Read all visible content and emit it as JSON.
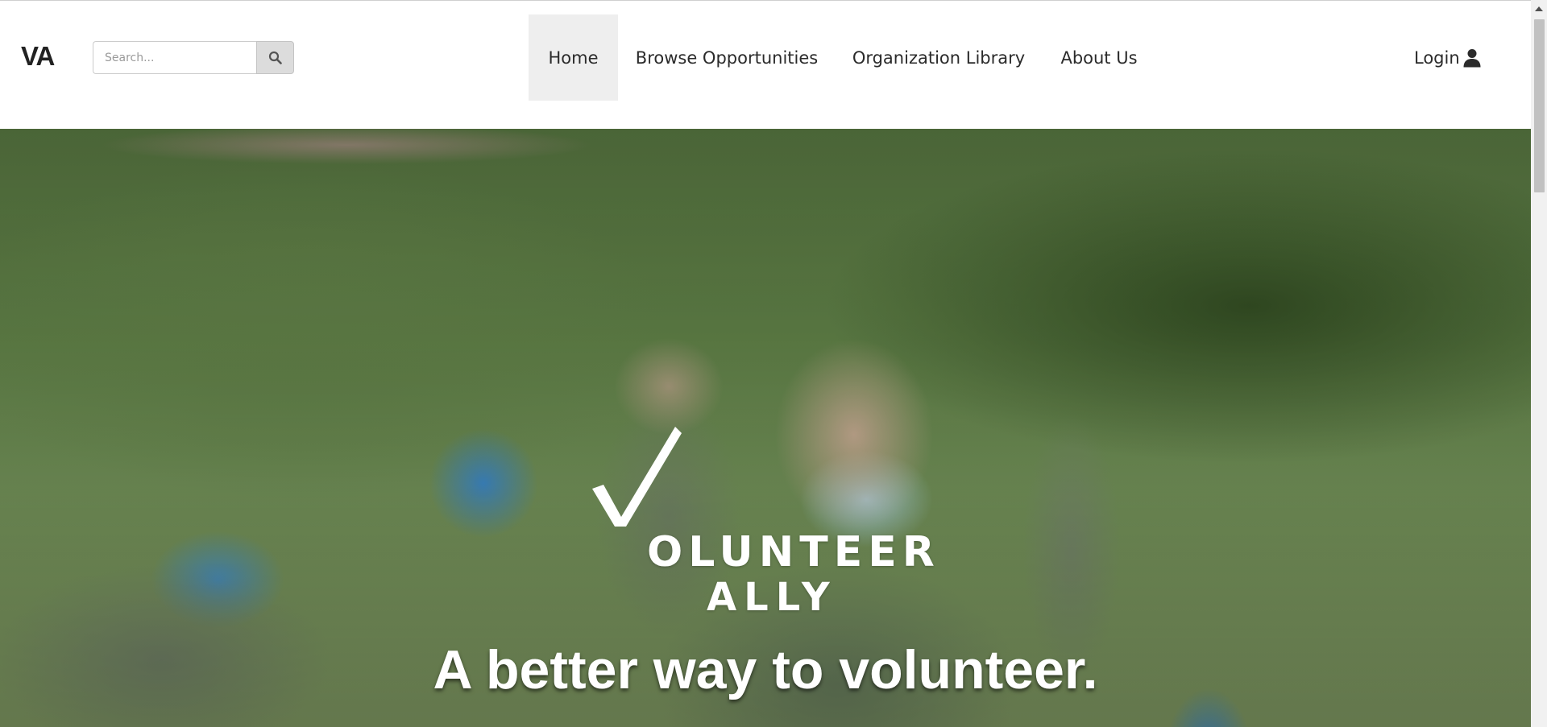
{
  "header": {
    "brand": "VA",
    "search": {
      "placeholder": "Search...",
      "value": ""
    },
    "nav": [
      {
        "label": "Home",
        "active": true
      },
      {
        "label": "Browse Opportunities",
        "active": false
      },
      {
        "label": "Organization Library",
        "active": false
      },
      {
        "label": "About Us",
        "active": false
      }
    ],
    "login_label": "Login"
  },
  "hero": {
    "logo_line1": "OLUNTEER",
    "logo_line2": "ALLY",
    "tagline": "A better way to volunteer."
  },
  "icons": {
    "search": "search-icon",
    "user": "user-icon",
    "logo_check": "checkmark-icon"
  },
  "colors": {
    "nav_active_bg": "#eeeeee",
    "search_button_bg": "#dcdcdc",
    "text": "#2b2b2b"
  }
}
